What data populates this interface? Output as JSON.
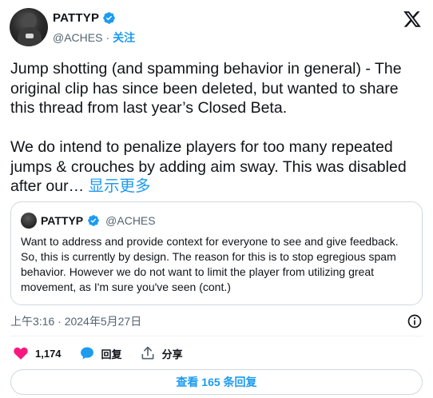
{
  "author": {
    "display_name": "PATTYP",
    "handle": "@ACHES",
    "separator": "·",
    "follow_label": "关注"
  },
  "tweet": {
    "text": "Jump shotting (and spamming behavior in general) - The original clip has since been deleted, but wanted to share this thread from last year’s Closed Beta.\n\nWe do intend to penalize players for too many repeated jumps & crouches by adding aim sway. This was disabled after our… ",
    "show_more_label": "显示更多"
  },
  "quote": {
    "display_name": "PATTYP",
    "handle": "@ACHES",
    "text": "Want to address and provide context for everyone to see and give feedback. So, this is currently by design. The reason for this is to stop egregious spam behavior. However we do not want to limit the player from utilizing great movement, as I'm sure you've seen (cont.)"
  },
  "meta": {
    "timestamp": "上午3:16 · 2024年5月27日"
  },
  "actions": {
    "likes": "1,174",
    "reply_label": "回复",
    "share_label": "分享"
  },
  "replies_button": {
    "label": "查看 165 条回复"
  },
  "colors": {
    "accent": "#1d9bf0",
    "like": "#f91880",
    "muted": "#536471",
    "border": "#cfd9de"
  },
  "icons": [
    "verified-badge-icon",
    "x-logo-icon",
    "info-icon",
    "heart-icon",
    "reply-bubble-icon",
    "share-icon"
  ]
}
